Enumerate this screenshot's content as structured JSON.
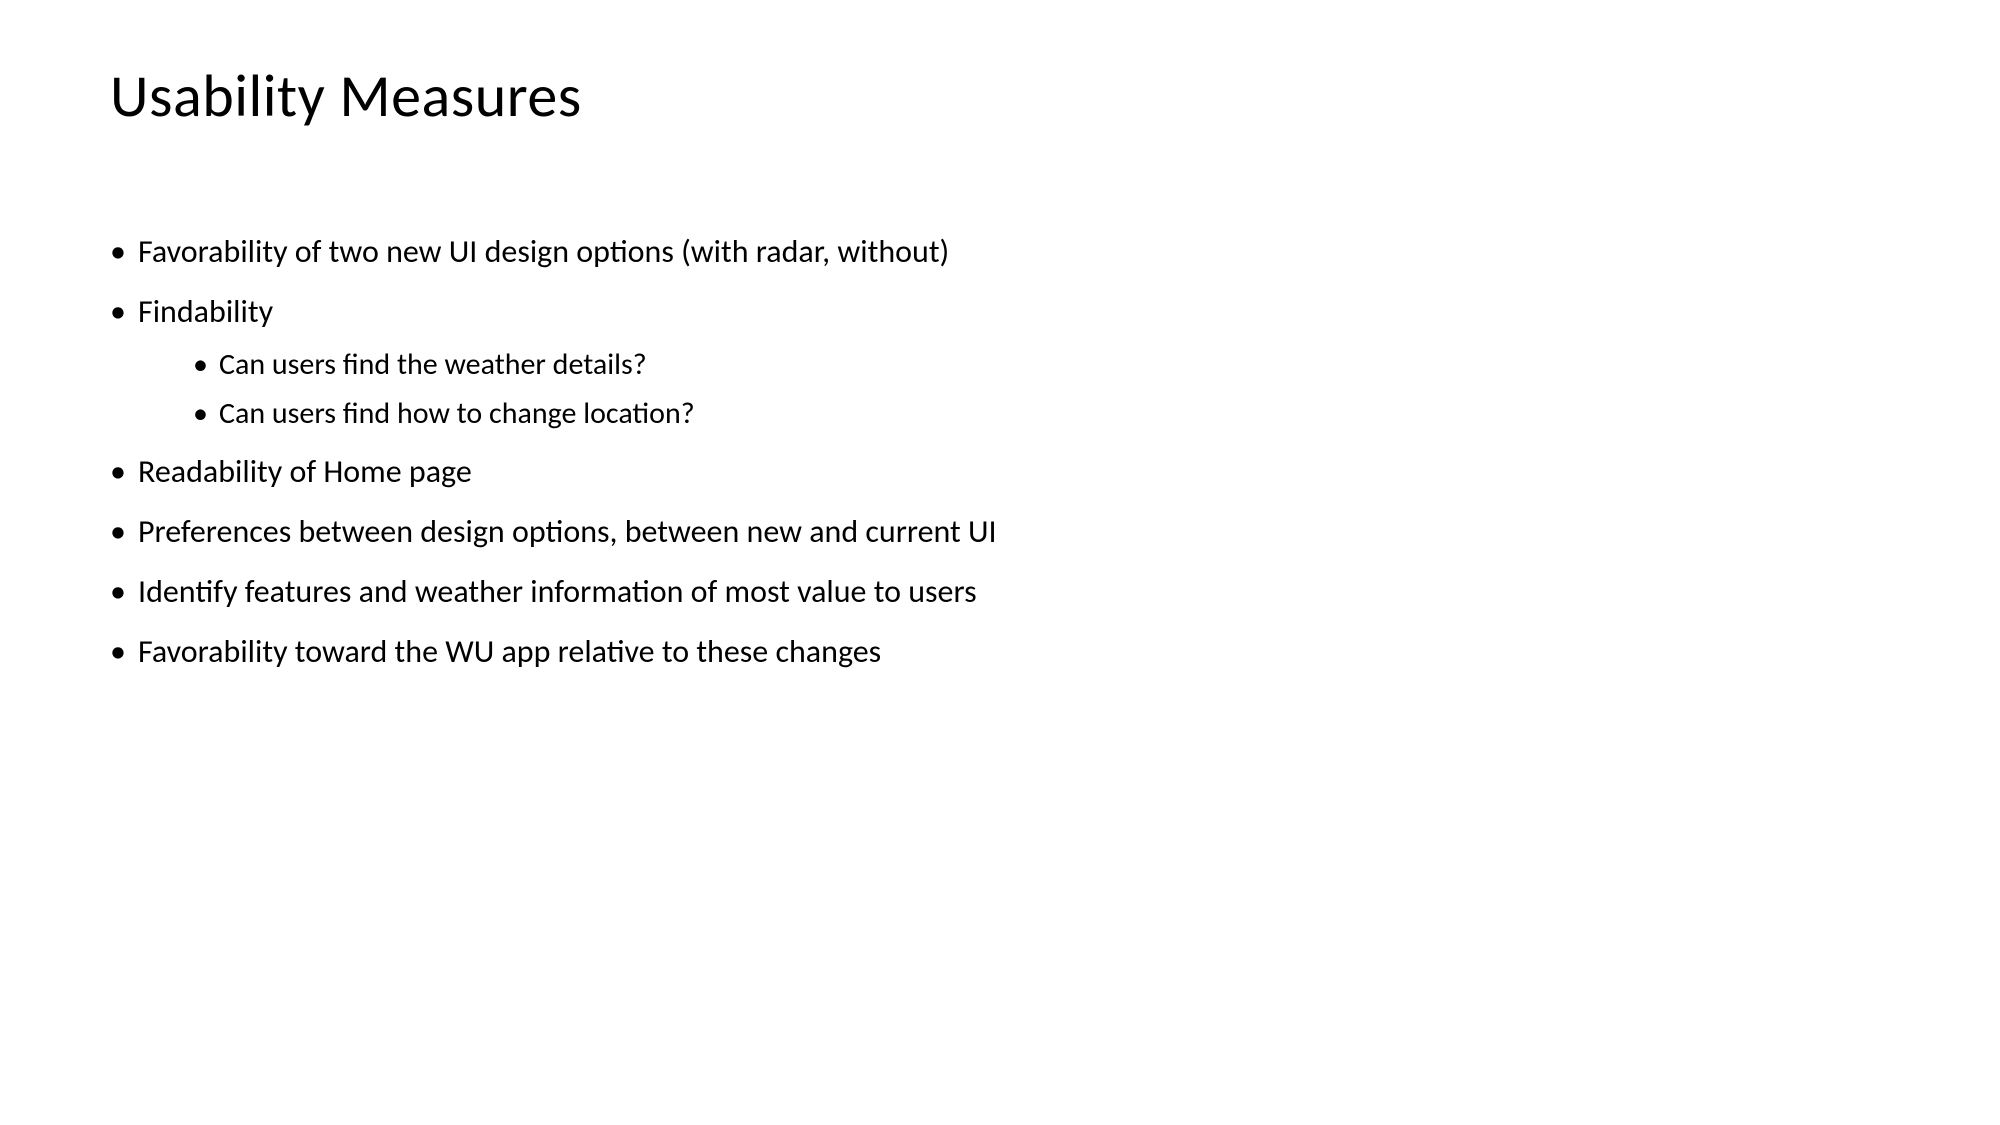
{
  "title": "Usability Measures",
  "items": [
    {
      "text": "Favorability of two new UI design options (with radar, without)"
    },
    {
      "text": "Findability",
      "subitems": [
        {
          "text": "Can users find the weather details?"
        },
        {
          "text": "Can users find how to change location?"
        }
      ]
    },
    {
      "text": "Readability of Home page"
    },
    {
      "text": "Preferences between design options, between new and current UI"
    },
    {
      "text": "Identify features and weather information of most value to users"
    },
    {
      "text": "Favorability toward the WU app relative to these changes"
    }
  ]
}
